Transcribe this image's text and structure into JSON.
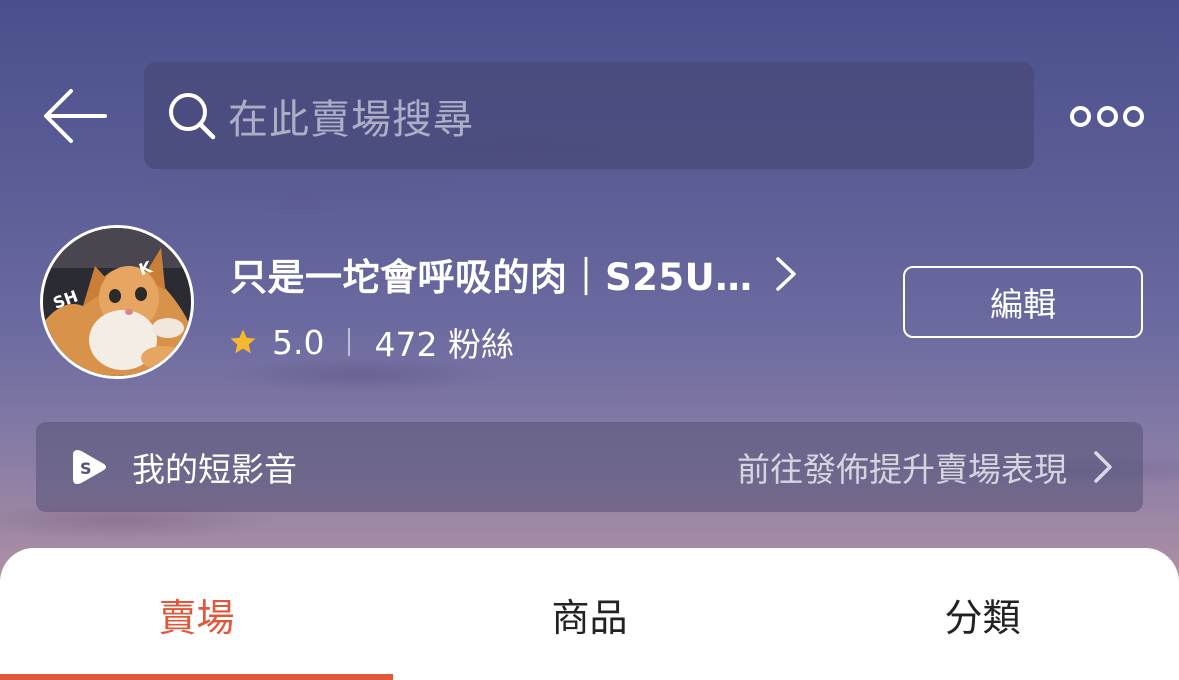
{
  "header": {
    "back_icon": "back-arrow-icon",
    "search_placeholder": "在此賣場搜尋",
    "search_icon": "search-icon",
    "more_icon": "more-dots-icon"
  },
  "profile": {
    "avatar_text": "SH K",
    "shop_name": "只是一坨會呼吸的肉｜S25U…",
    "rating": "5.0",
    "followers": "472 粉絲",
    "edit_label": "編輯"
  },
  "short_video": {
    "label": "我的短影音",
    "cta": "前往發佈提升賣場表現"
  },
  "tabs": [
    {
      "label": "賣場",
      "active": true
    },
    {
      "label": "商品",
      "active": false
    },
    {
      "label": "分類",
      "active": false
    }
  ],
  "colors": {
    "accent": "#e0573a",
    "star": "#f5b82e"
  }
}
